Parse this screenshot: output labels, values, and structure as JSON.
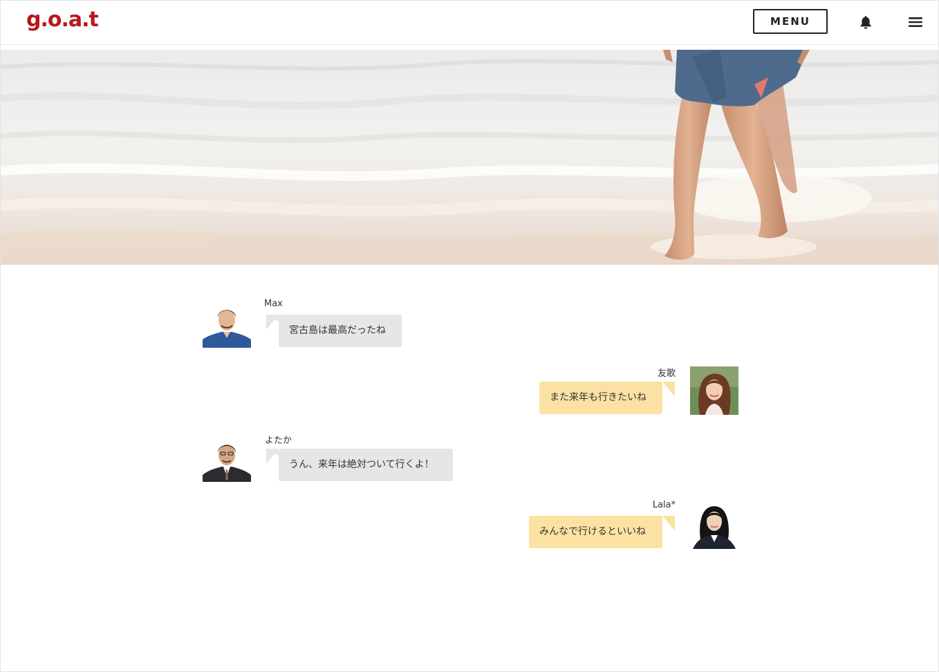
{
  "header": {
    "logo_text": "g.o.a.t",
    "menu_label": "MENU",
    "brand_color": "#b8161c"
  },
  "icons": {
    "notification": "bell-icon",
    "nav": "hamburger-menu-icon"
  },
  "hero": {
    "image": "beach-wave-feet-photo"
  },
  "chat": {
    "messages": [
      {
        "side": "left",
        "name": "Max",
        "text": "宮古島は最高だったね",
        "avatar": "man-blue-shirt-avatar"
      },
      {
        "side": "right",
        "name": "友歌",
        "text": "また来年も行きたいね",
        "avatar": "woman-long-hair-avatar"
      },
      {
        "side": "left",
        "name": "よたか",
        "text": "うん、来年は絶対ついて行くよ！",
        "avatar": "man-suit-avatar"
      },
      {
        "side": "right",
        "name": "Lala*",
        "text": "みんなで行けるといいね",
        "avatar": "woman-black-hair-avatar"
      }
    ],
    "colors": {
      "left_bubble": "#e6e6e6",
      "right_bubble": "#fbe2a3"
    }
  }
}
